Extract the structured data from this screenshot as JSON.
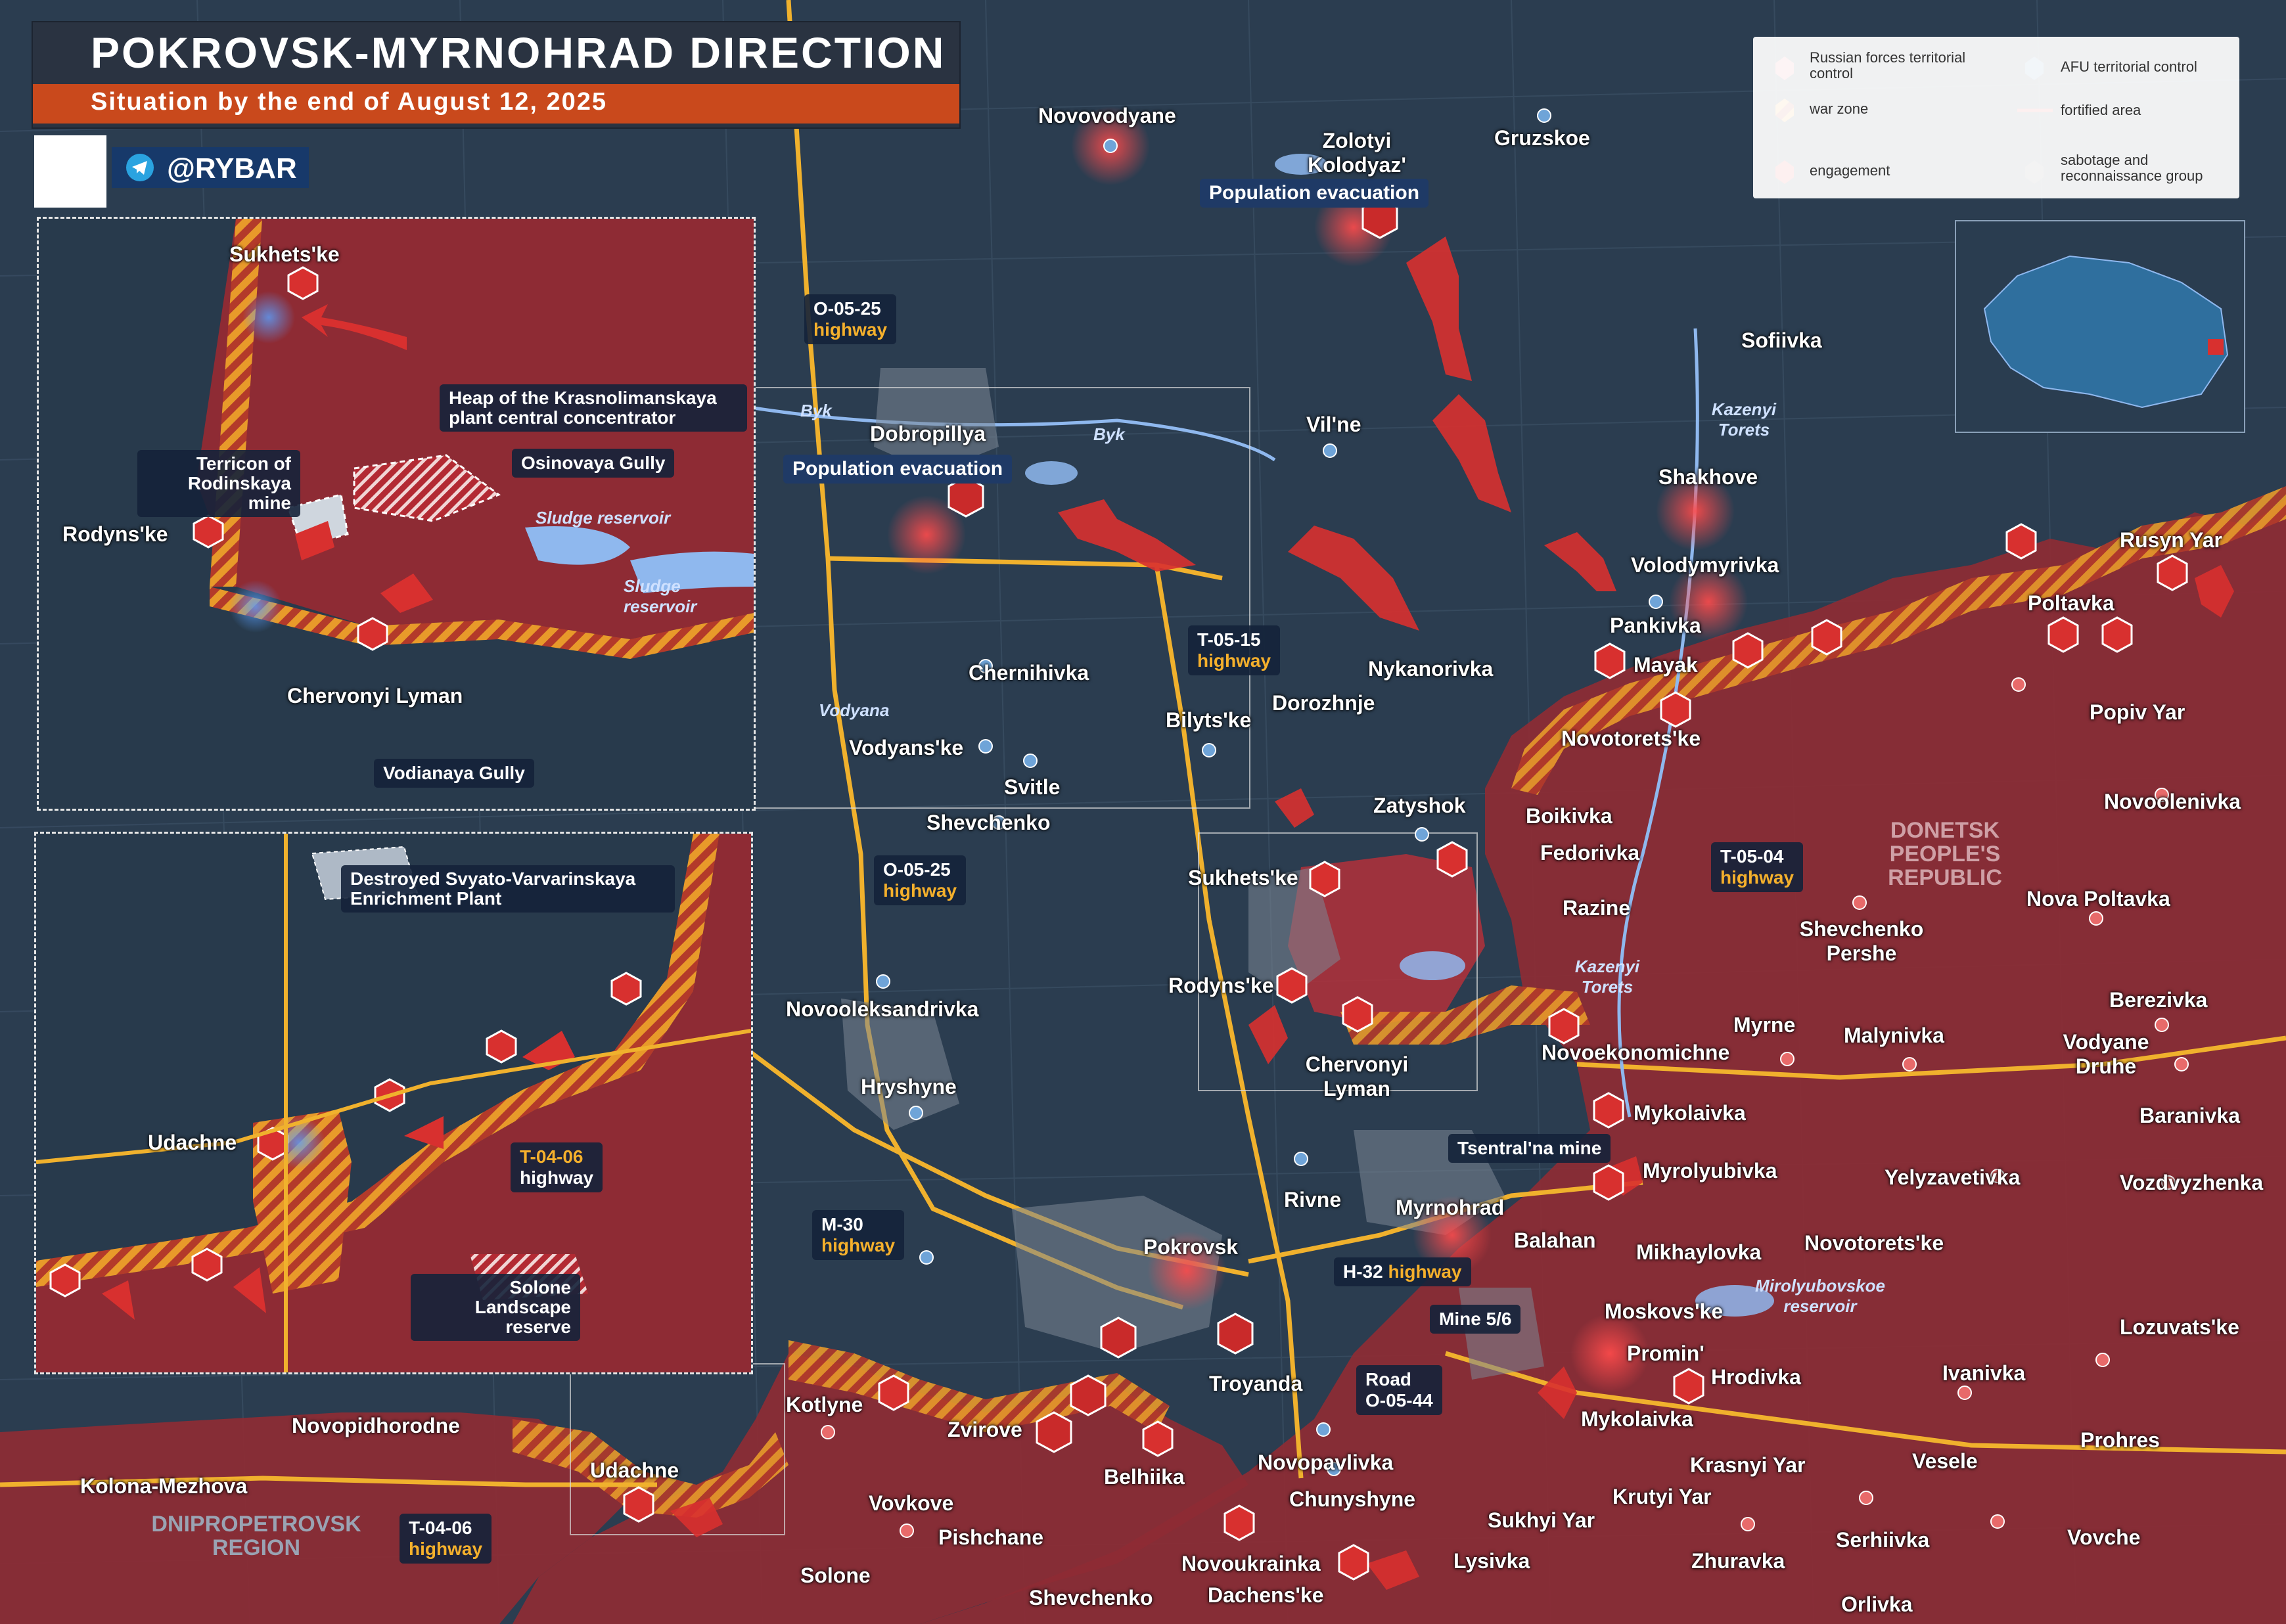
{
  "title": {
    "main": "POKROVSK-MYRNOHRAD DIRECTION",
    "subtitle": "Situation by the end of August 12, 2025",
    "brand": "@RYBAR"
  },
  "legend": {
    "russian_control": "Russian forces territorial control",
    "afu_control": "AFU territorial control",
    "war_zone": "war zone",
    "fortified_area": "fortified area",
    "engagement": "engagement",
    "sabotage": "sabotage and reconnaissance group"
  },
  "colors": {
    "russian": "#b32a33",
    "afu": "#1f3d63",
    "war_zone": "#e89a2a",
    "title_accent": "#c9491c",
    "highway": "#f0b12d",
    "background": "#27384a"
  },
  "regions": {
    "dnipro": "DNIPROPETROVSK REGION",
    "dpr": "DONETSK PEOPLE'S REPUBLIC"
  },
  "evacuation": [
    "Population evacuation",
    "Population evacuation"
  ],
  "roads": {
    "o0525_a": {
      "code": "O-05-25",
      "type": "highway"
    },
    "o0525_b": {
      "code": "O-05-25",
      "type": "highway"
    },
    "t0515": {
      "code": "T-05-15",
      "type": "highway"
    },
    "t0504": {
      "code": "T-05-04",
      "type": "highway"
    },
    "m30": {
      "code": "M-30",
      "type": "highway"
    },
    "h32": {
      "code": "H-32",
      "type": "highway"
    },
    "t0406": {
      "code": "T-04-06",
      "type": "highway"
    },
    "t0406_inset": {
      "code": "T-04-06",
      "type": "highway"
    },
    "o0544": {
      "road": "Road",
      "code": "O-05-44"
    },
    "tsentralna": "Tsentral'na mine",
    "mine56": "Mine 5/6"
  },
  "water": {
    "byk1": "Byk",
    "byk2": "Byk",
    "vodyana": "Vodyana",
    "kazenyi1": "Kazenyi Torets",
    "kazenyi2": "Kazenyi Torets",
    "mirolyubovskoe": "Mirolyubovskoe reservoir",
    "sludge1": "Sludge reservoir",
    "sludge2": "Sludge reservoir"
  },
  "places": [
    "Novovodyane",
    "Zolotyi Kolodyaz'",
    "Gruzskoe",
    "Sofiivka",
    "Vil'ne",
    "Shakhove",
    "Volodymyrivka",
    "Rusyn Yar",
    "Pankivka",
    "Poltavka",
    "Mayak",
    "Nykanorivka",
    "Dorozhnje",
    "Popiv Yar",
    "Novotorets'ke",
    "Dobropillya",
    "Chernihivka",
    "Bilyts'ke",
    "Vodyans'ke",
    "Svitle",
    "Shevchenko",
    "Zatyshok",
    "Boikivka",
    "Fedorivka",
    "Novoolenivka",
    "Sukhets'ke",
    "Razine",
    "Shevchenko Pershe",
    "Nova Poltavka",
    "Novooleksandrivka",
    "Rodyns'ke",
    "Chervonyi Lyman",
    "Myrne",
    "Novoekonomichne",
    "Malynivka",
    "Berezivka",
    "Vodyane Druhe",
    "Hryshyne",
    "Mykolaivka",
    "Baranivka",
    "Myrolyubivka",
    "Yelyzavetivka",
    "Vozdvyzhenka",
    "Rivne",
    "Myrnohrad",
    "Balahan",
    "Mikhaylovka",
    "Novotorets'ke",
    "Pokrovsk",
    "Moskovs'ke",
    "Promin'",
    "Lozuvats'ke",
    "Troyanda",
    "Hrodivka",
    "Ivanivka",
    "Kotlyne",
    "Novopidhorodne",
    "Zvirove",
    "Mykolaivka",
    "Novopavlivka",
    "Krasnyi Yar",
    "Vesele",
    "Prohres",
    "Kolona-Mezhova",
    "Udachne",
    "Belhiika",
    "Chunyshyne",
    "Krutyi Yar",
    "Vovkove",
    "Pishchane",
    "Sukhyi Yar",
    "Serhiivka",
    "Vovche",
    "Novoukrainka",
    "Zhuravka",
    "Solone",
    "Lysivka",
    "Shevchenko",
    "Dachens'ke",
    "Orlivka"
  ],
  "inset_top": {
    "labels": [
      "Sukhets'ke",
      "Heap of the Krasnolimanskaya plant central concentrator",
      "Terricon of Rodinskaya mine",
      "Osinovaya Gully",
      "Rodyns'ke",
      "Chervonyi Lyman",
      "Vodianaya Gully"
    ]
  },
  "inset_bottom": {
    "labels": [
      "Destroyed Svyato-Varvarinskaya Enrichment Plant",
      "Udachne",
      "Solone Landscape reserve"
    ]
  }
}
